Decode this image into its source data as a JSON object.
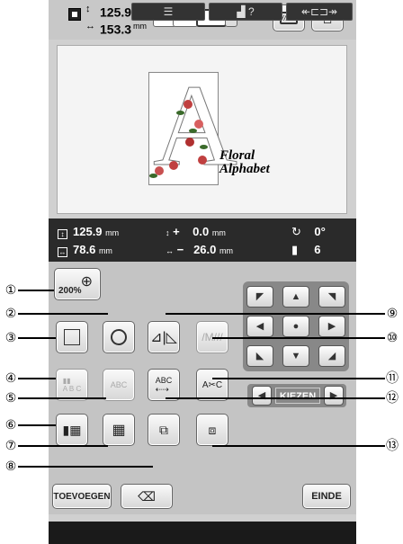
{
  "header": {
    "height_value": "125.9",
    "width_value": "153.3",
    "unit": "mm"
  },
  "hoop_buttons": [
    "+",
    "+",
    "+"
  ],
  "design": {
    "caption_line1": "Floral",
    "caption_line2": "Alphabet"
  },
  "info": {
    "height": "125.9",
    "width": "78.6",
    "unit": "mm",
    "vertical_offset_sign": "+",
    "vertical_offset": "0.0",
    "horizontal_offset_sign": "−",
    "horizontal_offset": "26.0",
    "angle": "0°",
    "color_count": "6"
  },
  "buttons": {
    "zoom": "200%",
    "select_label": "KIEZEN",
    "add": "TOEVOEGEN",
    "end": "EINDE"
  },
  "bottom_bar": {
    "help": "?"
  },
  "callouts": [
    "①",
    "②",
    "③",
    "④",
    "⑤",
    "⑥",
    "⑦",
    "⑧",
    "⑨",
    "⑩",
    "⑪",
    "⑫",
    "⑬"
  ]
}
